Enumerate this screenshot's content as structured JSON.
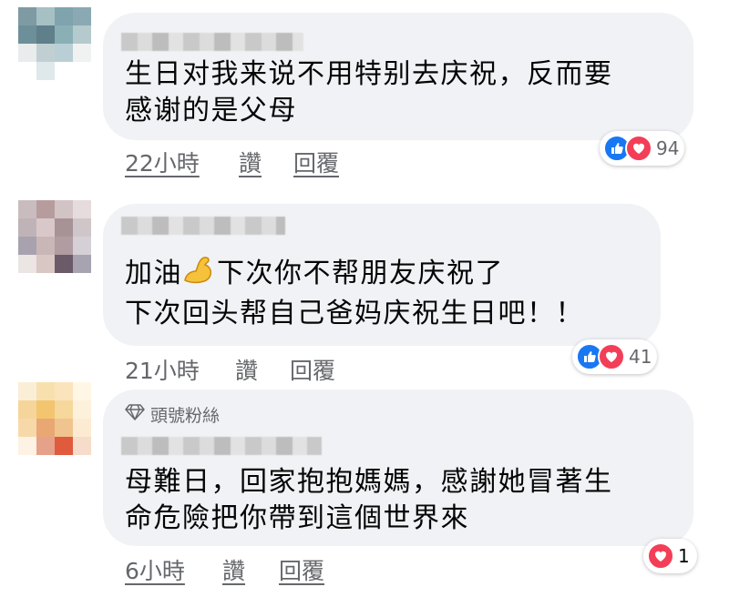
{
  "comments": [
    {
      "text": "生日对我来说不用特别去庆祝，反而要\n感谢的是父母",
      "time": "22小時",
      "like_label": "讚",
      "reply_label": "回覆",
      "reaction_count": "94"
    },
    {
      "text_line1_before": "加油",
      "text_line1_after": "下次你不帮朋友庆祝了",
      "text_line2": "下次回头帮自己爸妈庆祝生日吧！！",
      "time": "21小時",
      "like_label": "讚",
      "reply_label": "回覆",
      "reaction_count": "41"
    },
    {
      "badge": "頭號粉絲",
      "text": "母難日，回家抱抱媽媽，感謝她冒著生\n命危險把你帶到這個世界來",
      "time": "6小時",
      "like_label": "讚",
      "reply_label": "回覆",
      "reaction_count": "1"
    }
  ],
  "colors": {
    "bubble": "#f0f2f5",
    "meta_text": "#65676b",
    "like_blue": "#1877f2",
    "love_red": "#f33e58"
  },
  "icons": [
    "like-icon",
    "love-icon",
    "flexed-biceps-emoji",
    "diamond-icon"
  ]
}
